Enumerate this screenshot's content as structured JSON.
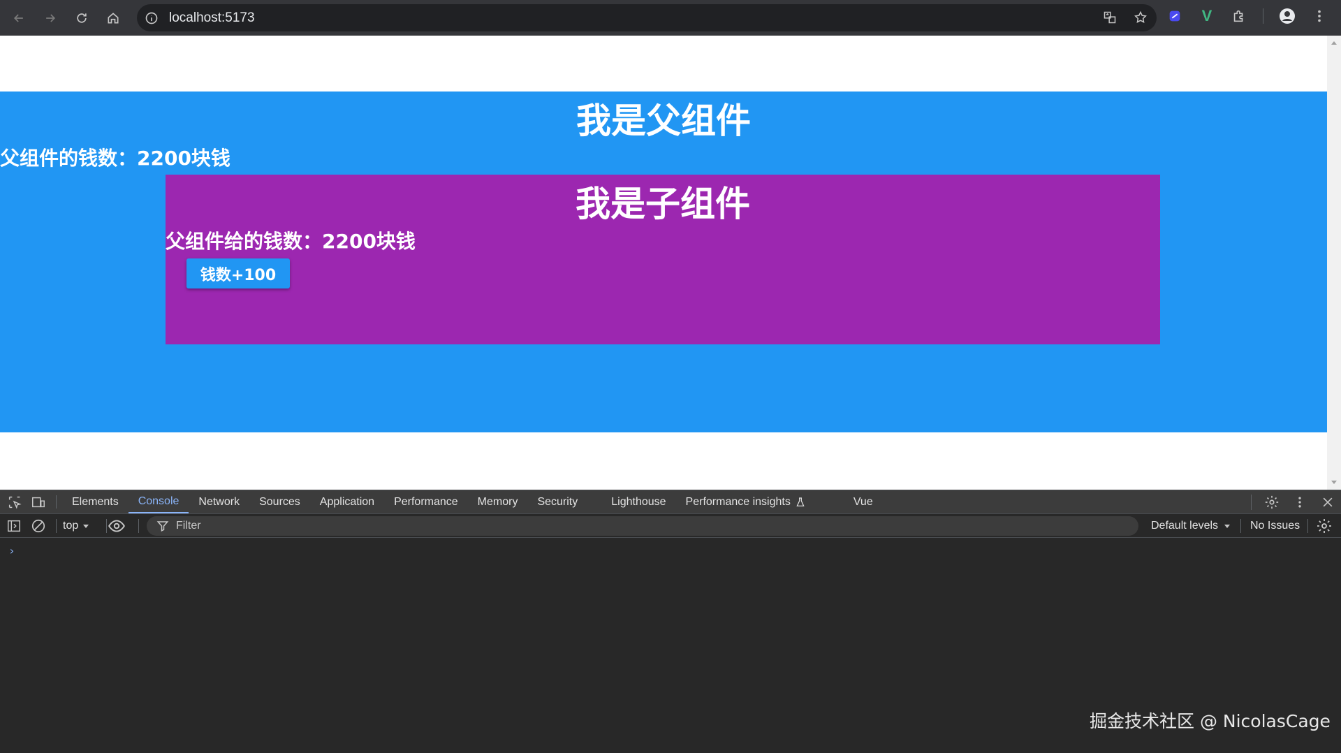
{
  "browser": {
    "url": "localhost:5173"
  },
  "page": {
    "parent": {
      "title": "我是父组件",
      "money_text": "父组件的钱数：2200块钱"
    },
    "child": {
      "title": "我是子组件",
      "money_text": "父组件给的钱数：2200块钱",
      "button_label": "钱数+100"
    },
    "colors": {
      "parent_bg": "#2196f3",
      "child_bg": "#9c27b0",
      "button_bg": "#2196f3"
    }
  },
  "devtools": {
    "tabs": [
      "Elements",
      "Console",
      "Network",
      "Sources",
      "Application",
      "Performance",
      "Memory",
      "Security",
      "Lighthouse",
      "Performance insights",
      "Vue"
    ],
    "active_tab": "Console",
    "toolbar": {
      "context": "top",
      "filter_placeholder": "Filter",
      "levels": "Default levels",
      "issues": "No Issues"
    },
    "prompt": "›"
  },
  "watermark": "掘金技术社区 @ NicolasCage"
}
